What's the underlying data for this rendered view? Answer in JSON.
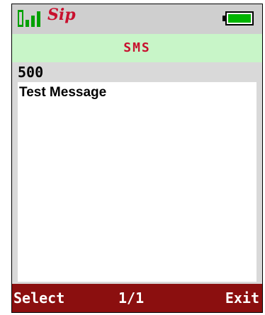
{
  "statusbar": {
    "signal_icon": "signal-strength-icon",
    "carrier": "Sip",
    "battery_icon": "battery-icon",
    "colors": {
      "carrier": "#c8102e",
      "battery_fill": "#00b400"
    }
  },
  "header": {
    "title": "SMS"
  },
  "message": {
    "recipient": "500",
    "body": "Test Message"
  },
  "softkeys": {
    "left": "Select",
    "center": "1/1",
    "right": "Exit"
  },
  "colors": {
    "softkey_bar": "#8b0f0f",
    "title_bar": "#c8f5c8",
    "title_text": "#c8102e"
  }
}
